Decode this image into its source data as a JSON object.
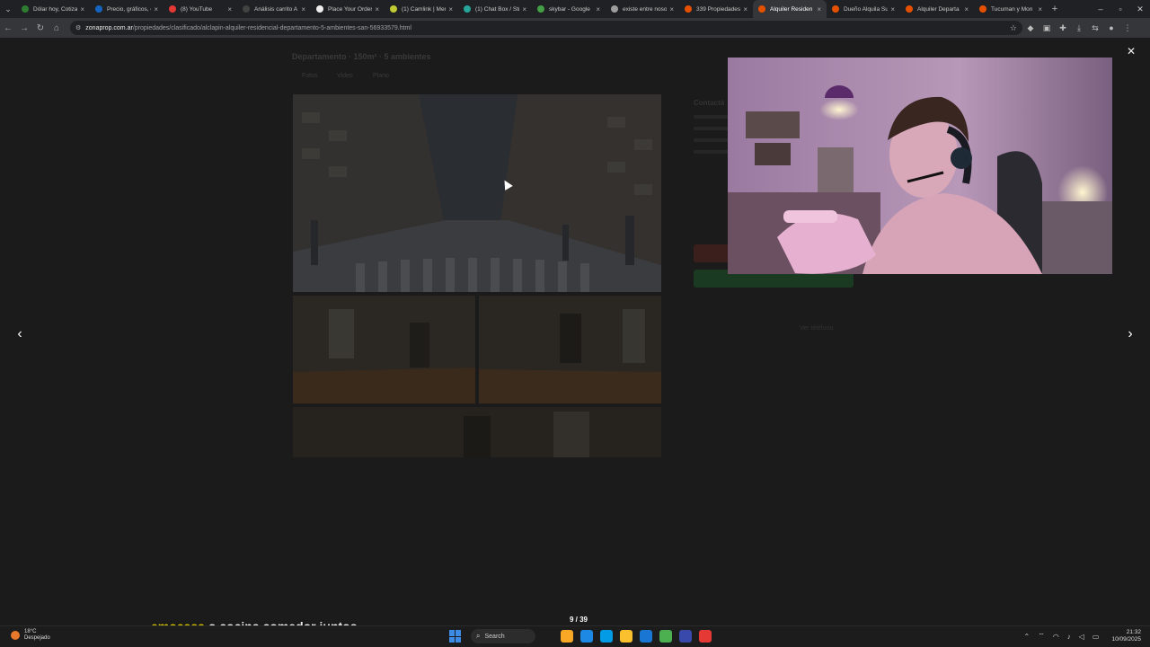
{
  "browser": {
    "tabs": [
      {
        "label": "Dólar hoy, Cotiza",
        "color": "#2e7d32"
      },
      {
        "label": "Precio, gráficos, c",
        "color": "#1565c0"
      },
      {
        "label": "(8) YouTube",
        "color": "#e53935"
      },
      {
        "label": "Análisis carrito A",
        "color": "#424242"
      },
      {
        "label": "Place Your Order",
        "color": "#eeeeee"
      },
      {
        "label": "(1) Camlink | Men",
        "color": "#c0ca33"
      },
      {
        "label": "(1) Chat Box / Str",
        "color": "#26a69a"
      },
      {
        "label": "skybar - Google",
        "color": "#43a047"
      },
      {
        "label": "existe entre noso",
        "color": "#9e9e9e"
      },
      {
        "label": "339 Propiedades",
        "color": "#e65100"
      },
      {
        "label": "Alquiler Residen",
        "color": "#e65100",
        "active": true
      },
      {
        "label": "Dueño Alquila Su",
        "color": "#e65100"
      },
      {
        "label": "Alquiler Departa",
        "color": "#e65100"
      },
      {
        "label": "Tucuman y Mon",
        "color": "#e65100"
      }
    ],
    "url_host": "zonaprop.com.ar",
    "url_path": "/propiedades/clasificado/alclapin-alquiler-residencial-departamento-5-ambientes-san-56933579.html"
  },
  "listing": {
    "title": "Departamento · 150m² · 5 ambientes",
    "tabs": [
      "Fotos",
      "Video",
      "Plano"
    ],
    "contact_title": "Contactá",
    "ghost_link": "Ver teléfono"
  },
  "lightbox": {
    "counter": "9 / 39",
    "prev_icon": "‹",
    "next_icon": "›",
    "close_icon": "✕"
  },
  "subtitle": {
    "highlight": "emocasa",
    "rest": " o cocina comedor juntos"
  },
  "taskbar": {
    "temperature": "18°C",
    "weather": "Despejado",
    "search_placeholder": "Search",
    "time": "21:32",
    "date": "10/09/2025",
    "icon_colors": [
      "#f9a825",
      "#1e88e5",
      "#039be5",
      "#fbc02d",
      "#1976d2",
      "#4caf50",
      "#3949ab",
      "#e53935"
    ]
  }
}
